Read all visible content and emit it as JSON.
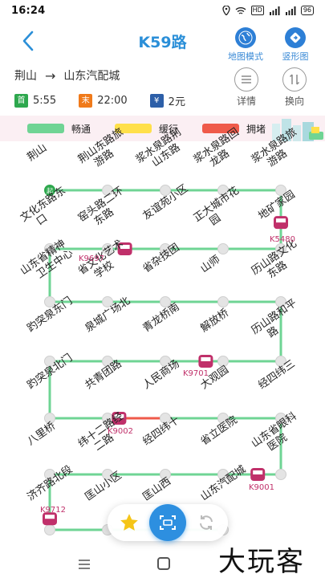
{
  "status_bar": {
    "time": "16:24",
    "hd": "HD",
    "signal1": "⁴⁶ᴳ",
    "signal2": "⁴⁶ᴳ",
    "battery": "96"
  },
  "header": {
    "title": "K59路",
    "map_mode_label": "地图模式",
    "vertical_label": "竖形图"
  },
  "route": {
    "from": "荆山",
    "to": "山东汽配城",
    "arrow": "→"
  },
  "info": {
    "first_tag": "首",
    "first_time": "5:55",
    "last_tag": "末",
    "last_time": "22:00",
    "fare_tag": "¥",
    "fare": "2元"
  },
  "actions": {
    "detail_label": "详情",
    "transfer_label": "换向"
  },
  "legend": {
    "items": [
      {
        "label": "畅通",
        "color": "#6fd494"
      },
      {
        "label": "缓行",
        "color": "#ffe04a"
      },
      {
        "label": "拥堵",
        "color": "#ef5a4a"
      }
    ]
  },
  "stops": [
    {
      "name": "荆山",
      "l1": "荆山",
      "l2": ""
    },
    {
      "name": "荆山东路旅游路",
      "l1": "荆山东路旅",
      "l2": "游路"
    },
    {
      "name": "浆水泉路荆山东路",
      "l1": "浆水泉路荆",
      "l2": "山东路"
    },
    {
      "name": "浆水泉路回龙路",
      "l1": "浆水泉路回",
      "l2": "龙路"
    },
    {
      "name": "浆水泉路旅游路",
      "l1": "浆水泉路旅",
      "l2": "游路"
    },
    {
      "name": "地矿家园",
      "l1": "地矿家园",
      "l2": ""
    },
    {
      "name": "正大城市花园",
      "l1": "正大城市花",
      "l2": "园"
    },
    {
      "name": "友谊苑小区",
      "l1": "友谊苑小区",
      "l2": ""
    },
    {
      "name": "窑头路二环东路",
      "l1": "窑头路二环",
      "l2": "东路"
    },
    {
      "name": "文化东路东口",
      "l1": "文化东路东",
      "l2": "口"
    },
    {
      "name": "山东省精神卫生中心",
      "l1": "山东省精神",
      "l2": "卫生中心"
    },
    {
      "name": "省文化艺术学校",
      "l1": "省文化艺术",
      "l2": "学校"
    },
    {
      "name": "省杂技团",
      "l1": "省杂技团",
      "l2": ""
    },
    {
      "name": "山师",
      "l1": "山师",
      "l2": ""
    },
    {
      "name": "历山路文化东路",
      "l1": "历山路文化",
      "l2": "东路"
    },
    {
      "name": "历山路和平路",
      "l1": "历山路和平",
      "l2": "路"
    },
    {
      "name": "解放桥",
      "l1": "解放桥",
      "l2": ""
    },
    {
      "name": "青龙桥南",
      "l1": "青龙桥南",
      "l2": ""
    },
    {
      "name": "泉城广场北",
      "l1": "泉城广场北",
      "l2": ""
    },
    {
      "name": "趵突泉东门",
      "l1": "趵突泉东门",
      "l2": ""
    },
    {
      "name": "趵突泉北门",
      "l1": "趵突泉北门",
      "l2": ""
    },
    {
      "name": "共青团路",
      "l1": "共青团路",
      "l2": ""
    },
    {
      "name": "人民商场",
      "l1": "人民商场",
      "l2": ""
    },
    {
      "name": "大观园",
      "l1": "大观园",
      "l2": ""
    },
    {
      "name": "经四纬三",
      "l1": "经四纬三",
      "l2": ""
    },
    {
      "name": "山东省眼科医院",
      "l1": "山东省眼科",
      "l2": "医院"
    },
    {
      "name": "省立医院",
      "l1": "省立医院",
      "l2": ""
    },
    {
      "name": "经四纬十",
      "l1": "经四纬十",
      "l2": ""
    },
    {
      "name": "纬十二路经二路",
      "l1": "纬十二路经",
      "l2": "二路"
    },
    {
      "name": "八里桥",
      "l1": "八里桥",
      "l2": ""
    },
    {
      "name": "济齐路北段",
      "l1": "济齐路北段",
      "l2": ""
    },
    {
      "name": "匡山小区",
      "l1": "匡山小区",
      "l2": ""
    },
    {
      "name": "匡山西",
      "l1": "匡山西",
      "l2": ""
    },
    {
      "name": "山东汽配城",
      "l1": "山东汽配城",
      "l2": ""
    }
  ],
  "start_tag": "起",
  "buses": [
    {
      "id": "K5480"
    },
    {
      "id": "K9697"
    },
    {
      "id": "K9701"
    },
    {
      "id": "K9002"
    },
    {
      "id": "K9001"
    },
    {
      "id": "K9712"
    }
  ],
  "watermark": "大玩客",
  "colors": {
    "accent": "#2b8fd8",
    "line_green": "#6fd494",
    "line_red": "#ef5a4a",
    "bus": "#c0306a"
  }
}
